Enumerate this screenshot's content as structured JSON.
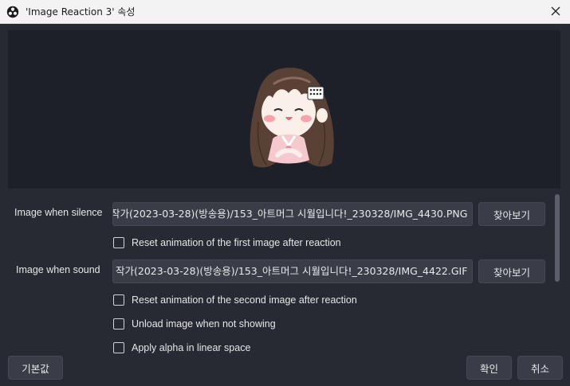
{
  "window": {
    "title": "'Image Reaction 3' 속성",
    "app_icon": "obs-logo-icon",
    "close_icon": "close-icon"
  },
  "preview": {
    "image": "chibi-character-image"
  },
  "properties": {
    "silence": {
      "label": "Image when silence",
      "value": "작가(2023-03-28)(방송용)/153_아트머그 시월입니다!_230328/IMG_4430.PNG",
      "browse": "찾아보기"
    },
    "reset_first": {
      "label": "Reset animation of the first image after reaction",
      "checked": false
    },
    "sound": {
      "label": "Image when sound",
      "value": "작가(2023-03-28)(방송용)/153_아트머그 시월입니다!_230328/IMG_4422.GIF",
      "browse": "찾아보기"
    },
    "reset_second": {
      "label": "Reset animation of the second image after reaction",
      "checked": false
    },
    "unload": {
      "label": "Unload image when not showing",
      "checked": false
    },
    "alpha": {
      "label": "Apply alpha in linear space",
      "checked": false
    }
  },
  "footer": {
    "defaults": "기본값",
    "ok": "확인",
    "cancel": "취소"
  }
}
